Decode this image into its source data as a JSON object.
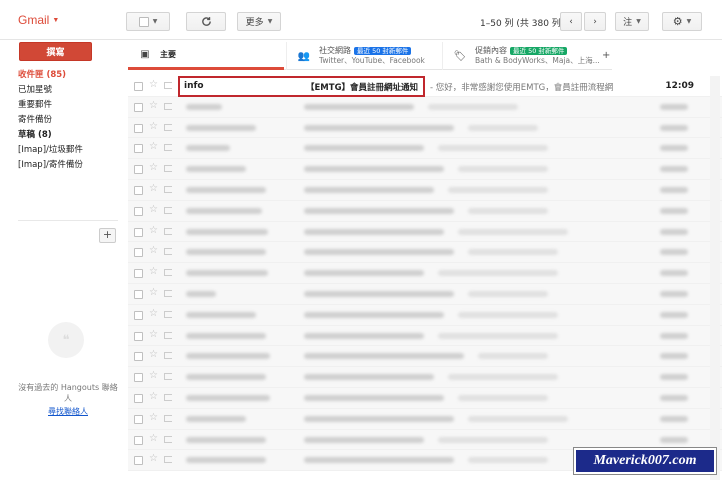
{
  "brand": {
    "name": "Gmail"
  },
  "toolbar": {
    "refresh_icon": "refresh-icon",
    "more_label": "更多",
    "page_info": "1–50 列 (共 380 列)",
    "lang_label": "注",
    "settings_icon": "gear-icon"
  },
  "compose_label": "撰寫",
  "nav": [
    {
      "label": "收件匣 (85)",
      "active": true
    },
    {
      "label": "已加星號"
    },
    {
      "label": "重要郵件"
    },
    {
      "label": "寄件備份"
    },
    {
      "label": "草稿 (8)",
      "bold": true
    },
    {
      "label": "[Imap]/垃圾郵件"
    },
    {
      "label": "[Imap]/寄件備份"
    }
  ],
  "hangouts": {
    "empty_text": "沒有過去的 Hangouts 聯絡人",
    "invite_link": "尋找聯絡人"
  },
  "tabs": {
    "primary": {
      "label": "主要"
    },
    "social": {
      "label": "社交網路",
      "badge": "最近 50 封新郵件",
      "sub": "Twitter、YouTube、Facebook"
    },
    "promo": {
      "label": "促銷內容",
      "badge": "最近 50 封新郵件",
      "sub": "Bath & BodyWorks、Maja、上海..."
    }
  },
  "first_email": {
    "sender": "info",
    "subject": "【EMTG】會員註冊網址通知",
    "snippet": "- 您好，非常感謝您使用EMTG，會員註冊流程網",
    "time": "12:09"
  },
  "watermark": "Maverick007.com"
}
